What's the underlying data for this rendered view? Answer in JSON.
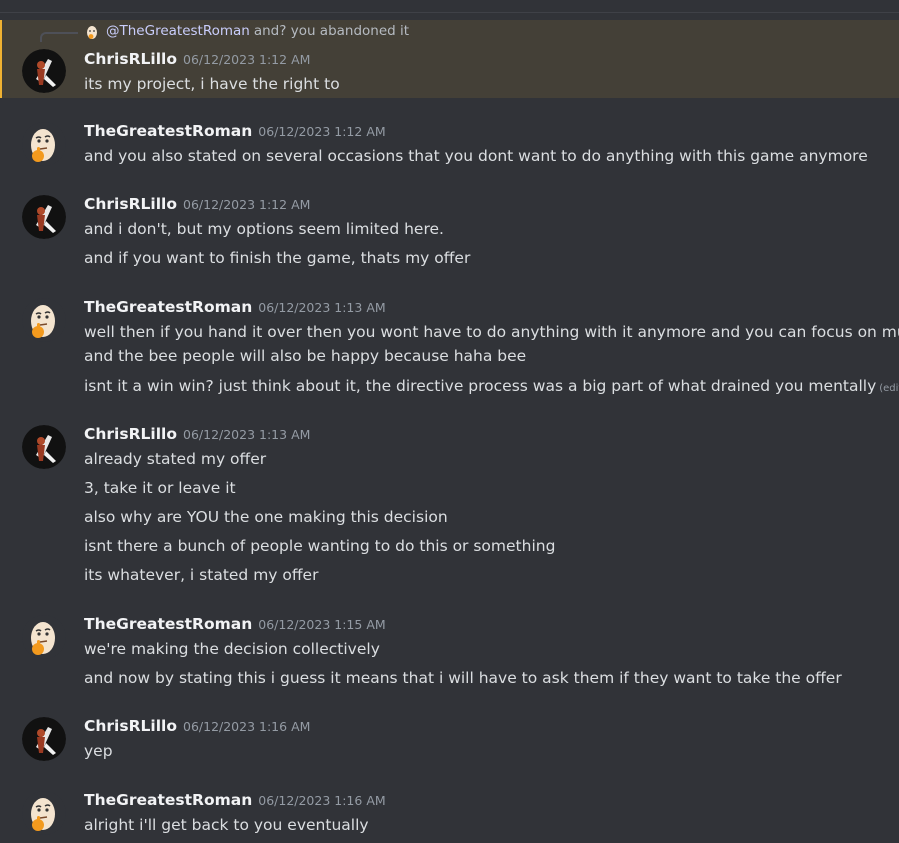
{
  "reply": {
    "mention": "@TheGreatestRoman",
    "text": "and? you abandoned it"
  },
  "messages": [
    {
      "author": "ChrisRLillo",
      "avatar_icon": "guitarist-avatar-icon",
      "timestamp": "06/12/2023 1:12 AM",
      "highlighted": true,
      "lines": [
        "its my project, i have the right to"
      ]
    },
    {
      "author": "TheGreatestRoman",
      "avatar_icon": "thinking-egg-avatar-icon",
      "timestamp": "06/12/2023 1:12 AM",
      "lines": [
        "and you also stated on several occasions that you dont want to do anything with this game anymore"
      ]
    },
    {
      "author": "ChrisRLillo",
      "avatar_icon": "guitarist-avatar-icon",
      "timestamp": "06/12/2023 1:12 AM",
      "lines": [
        "and i don't, but my options seem limited here.",
        "and if you want to finish the game, thats my offer"
      ]
    },
    {
      "author": "TheGreatestRoman",
      "avatar_icon": "thinking-egg-avatar-icon",
      "timestamp": "06/12/2023 1:13 AM",
      "lines": [
        "well then if you hand it over then you wont have to do anything with it anymore and you can focus on music",
        "and the bee people will also be happy because haha bee",
        "isnt it a win win? just think about it, the directive process was a big part of what drained you mentally"
      ],
      "edited_label": "(edited)"
    },
    {
      "author": "ChrisRLillo",
      "avatar_icon": "guitarist-avatar-icon",
      "timestamp": "06/12/2023 1:13 AM",
      "lines": [
        "already stated my offer",
        "3, take it or leave it",
        "also why are YOU the one making this decision",
        "isnt there a bunch of people wanting to do this or something",
        "its whatever, i stated my offer"
      ]
    },
    {
      "author": "TheGreatestRoman",
      "avatar_icon": "thinking-egg-avatar-icon",
      "timestamp": "06/12/2023 1:15 AM",
      "lines": [
        "we're making the decision collectively",
        "and now by stating this i guess it means that i will have to ask them if they want to take the offer"
      ]
    },
    {
      "author": "ChrisRLillo",
      "avatar_icon": "guitarist-avatar-icon",
      "timestamp": "06/12/2023 1:16 AM",
      "lines": [
        "yep"
      ]
    },
    {
      "author": "TheGreatestRoman",
      "avatar_icon": "thinking-egg-avatar-icon",
      "timestamp": "06/12/2023 1:16 AM",
      "lines": [
        "alright i'll get back to you eventually"
      ]
    }
  ],
  "colors": {
    "background": "#313338",
    "highlight_background": "#444037",
    "highlight_bar": "#f0b232",
    "username": "#f2f3f5",
    "timestamp": "#949ba4",
    "message_text": "#dbdee1",
    "mention": "#c9cdfb"
  }
}
